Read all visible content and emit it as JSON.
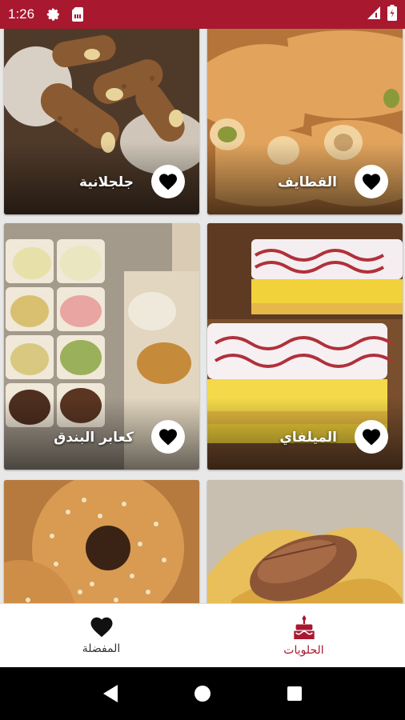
{
  "status_bar": {
    "time": "1:26",
    "icons": [
      "gear-icon",
      "sim-card-icon",
      "signal-icon",
      "battery-icon"
    ]
  },
  "colors": {
    "accent": "#a8182f",
    "nav_active": "#a8182f",
    "nav_inactive": "#333333"
  },
  "grid": {
    "cards": [
      {
        "name": "جلجلانية",
        "favorite_icon": "heart-icon"
      },
      {
        "name": "القطايف",
        "favorite_icon": "heart-icon"
      },
      {
        "name": "كعابر البندق",
        "favorite_icon": "heart-icon"
      },
      {
        "name": "الميلفاي",
        "favorite_icon": "heart-icon"
      },
      {
        "name": "",
        "favorite_icon": ""
      },
      {
        "name": "",
        "favorite_icon": ""
      }
    ]
  },
  "bottom_nav": {
    "items": [
      {
        "label": "الحلويات",
        "icon": "cake-icon",
        "active": true
      },
      {
        "label": "المفضلة",
        "icon": "heart-icon",
        "active": false
      }
    ]
  },
  "system_nav": {
    "icons": [
      "back-icon",
      "home-icon",
      "recents-icon"
    ]
  }
}
